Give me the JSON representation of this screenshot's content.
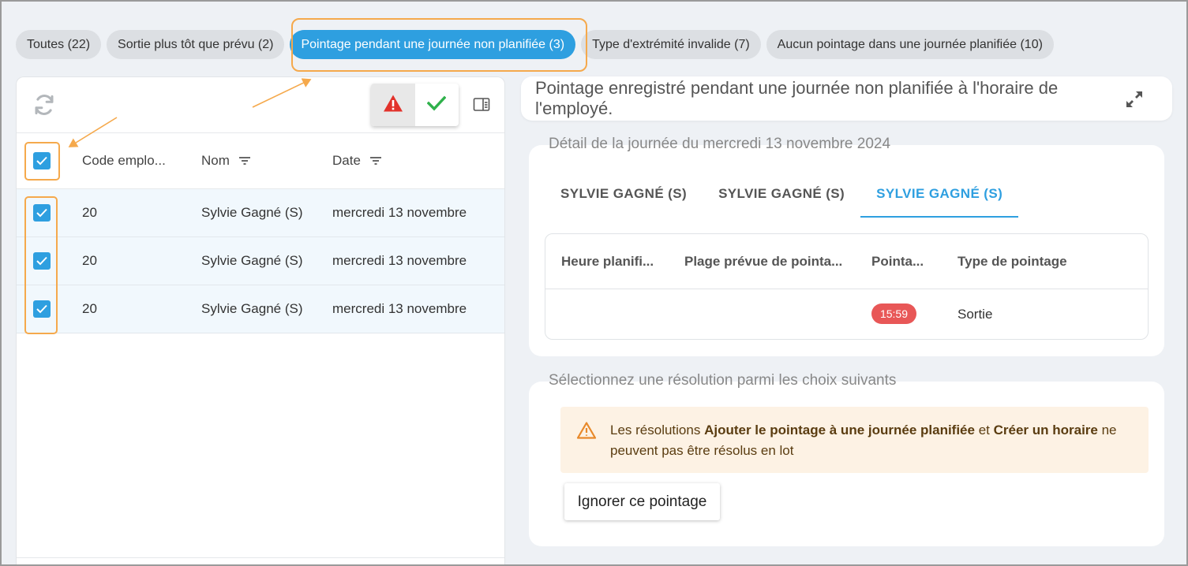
{
  "filters": [
    {
      "label": "Toutes (22)",
      "active": false
    },
    {
      "label": "Sortie plus tôt que prévu (2)",
      "active": false
    },
    {
      "label": "Pointage pendant une journée non planifiée (3)",
      "active": true
    },
    {
      "label": "Type d'extrémité invalide (7)",
      "active": false
    },
    {
      "label": "Aucun pointage dans une journée planifiée (10)",
      "active": false
    }
  ],
  "list": {
    "columns": {
      "code": "Code emplo...",
      "name": "Nom",
      "date": "Date"
    },
    "rows": [
      {
        "code": "20",
        "name": "Sylvie Gagné (S)",
        "date": "mercredi 13 novembre",
        "checked": true
      },
      {
        "code": "20",
        "name": "Sylvie Gagné (S)",
        "date": "mercredi 13 novembre",
        "checked": true
      },
      {
        "code": "20",
        "name": "Sylvie Gagné (S)",
        "date": "mercredi 13 novembre",
        "checked": true
      }
    ]
  },
  "description": "Pointage enregistré pendant une journée non planifiée à l'horaire de l'employé.",
  "day_detail": {
    "legend": "Détail de la journée du mercredi 13 novembre 2024",
    "tabs": [
      "SYLVIE GAGNÉ (S)",
      "SYLVIE GAGNÉ (S)",
      "SYLVIE GAGNÉ (S)"
    ],
    "active_tab": 2,
    "columns": {
      "heure": "Heure planifi...",
      "plage": "Plage prévue de pointa...",
      "pointage": "Pointa...",
      "type": "Type de pointage"
    },
    "row": {
      "heure": "",
      "plage": "",
      "pointage": "15:59",
      "type": "Sortie"
    }
  },
  "resolution": {
    "legend": "Sélectionnez une résolution parmi les choix suivants",
    "warning": {
      "part1": "Les résolutions ",
      "bold1": "Ajouter le pointage à une journée planifiée",
      "part2": " et ",
      "bold2": "Créer un horaire",
      "part3": " ne peuvent pas être résolus en lot"
    },
    "ignore_label": "Ignorer ce pointage"
  },
  "colors": {
    "accent": "#2e9fe0",
    "highlight": "#f5a94c",
    "badge_red": "#e85757",
    "warn_bg": "#fdf2e4"
  }
}
